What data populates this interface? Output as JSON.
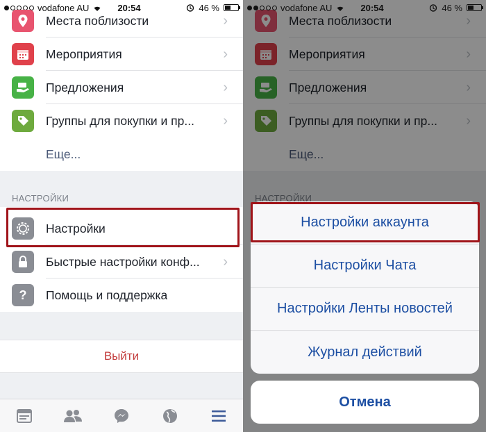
{
  "status_bar": {
    "carrier": "vodafone AU",
    "time": "20:54",
    "battery": "46 %",
    "battery_level": 0.46
  },
  "menu": {
    "items": [
      {
        "label": "Места поблизости",
        "icon": "location-pin-icon",
        "color": "#e8546f"
      },
      {
        "label": "Мероприятия",
        "icon": "calendar-icon",
        "color": "#e0414b"
      },
      {
        "label": "Предложения",
        "icon": "offer-hands-icon",
        "color": "#47b246"
      },
      {
        "label": "Группы для покупки и пр...",
        "icon": "shopping-tag-icon",
        "color": "#6eaa3e"
      }
    ],
    "more_label": "Еще..."
  },
  "settings_section": {
    "header": "НАСТРОЙКИ",
    "items": [
      {
        "label": "Настройки",
        "icon": "gear-icon",
        "color": "#8a8d94"
      },
      {
        "label": "Быстрые настройки конф...",
        "icon": "lock-icon",
        "color": "#8a8d94"
      },
      {
        "label": "Помощь и поддержка",
        "icon": "question-icon",
        "color": "#8a8d94"
      }
    ]
  },
  "logout_label": "Выйти",
  "tabbar": {
    "tabs": [
      {
        "icon": "news-feed-icon"
      },
      {
        "icon": "friends-icon"
      },
      {
        "icon": "messenger-icon"
      },
      {
        "icon": "globe-icon"
      },
      {
        "icon": "hamburger-menu-icon"
      }
    ],
    "active_color": "#3b5998",
    "inactive_color": "#8a8d94"
  },
  "action_sheet": {
    "buttons": [
      "Настройки аккаунта",
      "Настройки Чата",
      "Настройки Ленты новостей",
      "Журнал действий"
    ],
    "cancel_label": "Отмена"
  },
  "colors": {
    "highlight": "#a0141a",
    "sheet_text": "#1d4fa3",
    "logout_text": "#c23b3b"
  }
}
